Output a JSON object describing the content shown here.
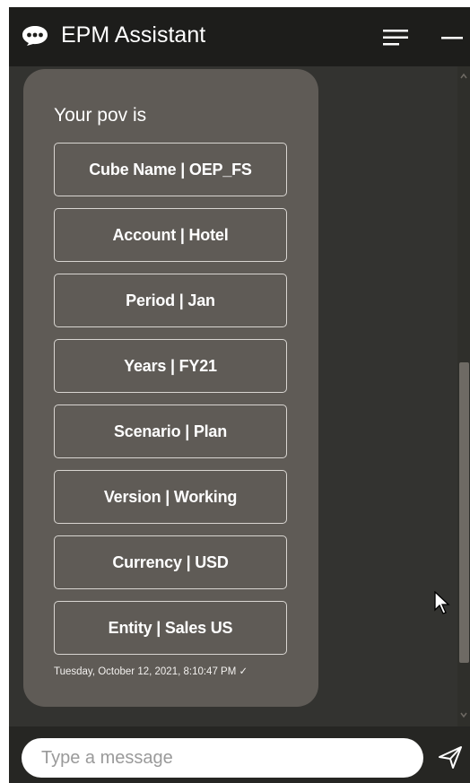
{
  "header": {
    "title": "EPM Assistant",
    "logo_icon": "chat-bubble-icon",
    "menu_icon": "hamburger-menu-icon",
    "minimize_icon": "minimize-icon"
  },
  "message": {
    "intro": "Your pov is",
    "buttons": [
      "Cube Name | OEP_FS",
      "Account | Hotel",
      "Period | Jan",
      "Years | FY21",
      "Scenario | Plan",
      "Version | Working",
      "Currency | USD",
      "Entity | Sales US"
    ],
    "timestamp": "Tuesday, October 12, 2021, 8:10:47 PM ✓"
  },
  "footer": {
    "placeholder": "Type a message",
    "send_icon": "send-icon"
  },
  "colors": {
    "header_bg": "#1d1d1b",
    "chat_bg": "#333330",
    "bubble_bg": "#5f5b56",
    "button_border": "#d8d5d1"
  }
}
